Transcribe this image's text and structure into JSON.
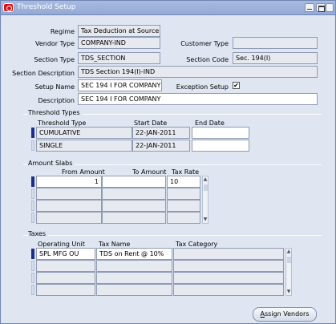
{
  "window": {
    "title": "Threshold Setup"
  },
  "header": {
    "regime_label": "Regime",
    "regime_value": "Tax Deduction at Source",
    "vendor_type_label": "Vendor Type",
    "vendor_type_value": "COMPANY-IND",
    "customer_type_label": "Customer Type",
    "customer_type_value": "",
    "section_type_label": "Section Type",
    "section_type_value": "TDS_SECTION",
    "section_code_label": "Section Code",
    "section_code_value": "Sec. 194(I)",
    "section_desc_label": "Section Description",
    "section_desc_value": "TDS Section 194(I)-IND",
    "setup_name_label": "Setup Name",
    "setup_name_value": "SEC 194 I FOR COMPANY",
    "exception_label": "Exception Setup",
    "exception_checked": "✔",
    "description_label": "Description",
    "description_value": "SEC 194 I FOR COMPANY"
  },
  "threshold_types": {
    "group_title": "Threshold Types",
    "columns": [
      "Threshold Type",
      "Start Date",
      "End Date"
    ],
    "rows": [
      [
        "CUMULATIVE",
        "22-JAN-2011",
        ""
      ],
      [
        "SINGLE",
        "22-JAN-2011",
        ""
      ]
    ]
  },
  "amount_slabs": {
    "group_title": "Amount Slabs",
    "columns": [
      "From Amount",
      "To Amount",
      "Tax Rate"
    ],
    "rows": [
      [
        "1",
        "",
        "10"
      ],
      [
        "",
        "",
        ""
      ],
      [
        "",
        "",
        ""
      ],
      [
        "",
        "",
        ""
      ]
    ]
  },
  "taxes": {
    "group_title": "Taxes",
    "columns": [
      "Operating Unit",
      "Tax Name",
      "Tax Category"
    ],
    "rows": [
      [
        "SPL MFG OU",
        "TDS on Rent @ 10%",
        ""
      ],
      [
        "",
        "",
        ""
      ],
      [
        "",
        "",
        ""
      ],
      [
        "",
        "",
        ""
      ]
    ]
  },
  "buttons": {
    "assign_vendors_prefix": "A",
    "assign_vendors_rest": "ssign Vendors"
  },
  "colors": {
    "title_bar": "#93a9d6",
    "window_bg": "#dfe6f2",
    "current_record": "#1b2e8c"
  }
}
